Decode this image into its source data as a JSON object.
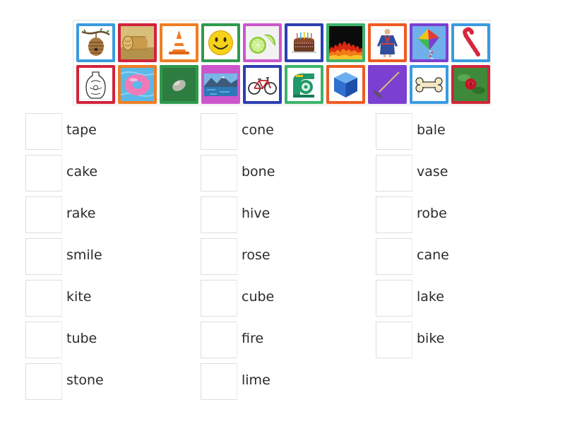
{
  "image_bank": {
    "tiles": [
      {
        "icon": "beehive-icon",
        "border_color": "#3a9be0"
      },
      {
        "icon": "hay-bale-icon",
        "border_color": "#d1233a"
      },
      {
        "icon": "traffic-cone-icon",
        "border_color": "#ef7e24"
      },
      {
        "icon": "smiley-face-icon",
        "border_color": "#2f9a4e"
      },
      {
        "icon": "lime-slice-icon",
        "border_color": "#cc56cc"
      },
      {
        "icon": "birthday-cake-icon",
        "border_color": "#2d3eb1"
      },
      {
        "icon": "fire-icon",
        "border_color": "#3db36b"
      },
      {
        "icon": "bathrobe-icon",
        "border_color": "#ee5b22"
      },
      {
        "icon": "kite-icon",
        "border_color": "#7b3fd1"
      },
      {
        "icon": "candy-cane-icon",
        "border_color": "#3a9be0"
      },
      {
        "icon": "vase-icon",
        "border_color": "#d1233a"
      },
      {
        "icon": "donut-tube-icon",
        "border_color": "#ef7e24"
      },
      {
        "icon": "stone-icon",
        "border_color": "#2f9a4e"
      },
      {
        "icon": "lake-icon",
        "border_color": "#cc56cc"
      },
      {
        "icon": "bicycle-icon",
        "border_color": "#2d3eb1"
      },
      {
        "icon": "tape-dispenser-icon",
        "border_color": "#3db36b"
      },
      {
        "icon": "cube-icon",
        "border_color": "#ee5b22"
      },
      {
        "icon": "rake-icon",
        "border_color": "#7b3fd1"
      },
      {
        "icon": "bone-icon",
        "border_color": "#3a9be0"
      },
      {
        "icon": "rose-icon",
        "border_color": "#d1233a"
      }
    ]
  },
  "columns": [
    {
      "words": [
        "tape",
        "cake",
        "rake",
        "smile",
        "kite",
        "tube",
        "stone"
      ]
    },
    {
      "words": [
        "cone",
        "bone",
        "hive",
        "rose",
        "cube",
        "fire",
        "lime"
      ]
    },
    {
      "words": [
        "bale",
        "vase",
        "robe",
        "cane",
        "lake",
        "bike"
      ]
    }
  ]
}
